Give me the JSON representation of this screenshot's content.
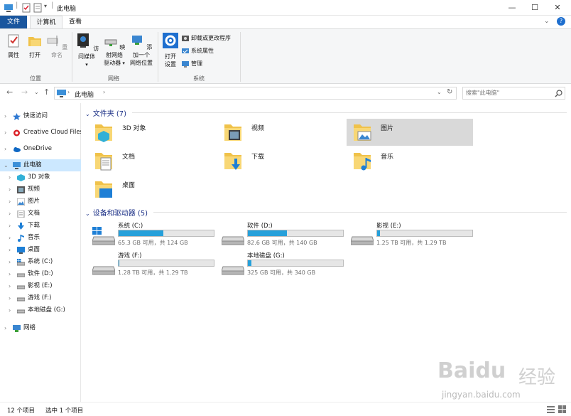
{
  "window": {
    "title": "此电脑"
  },
  "ribbon": {
    "tabs": [
      {
        "label": "文件"
      },
      {
        "label": "计算机"
      },
      {
        "label": "查看"
      }
    ],
    "groups": [
      {
        "label": "位置",
        "buttons": [
          {
            "label": "属性"
          },
          {
            "label": "打开"
          },
          {
            "label": "重命名"
          }
        ]
      },
      {
        "label": "网络",
        "buttons": [
          {
            "label": "访问媒体"
          },
          {
            "label": "映射网络驱动器"
          },
          {
            "label": "添加一个网络位置"
          }
        ]
      },
      {
        "label": "系统",
        "buttons": [
          {
            "label": "打开设置"
          }
        ],
        "small": [
          {
            "label": "卸载或更改程序"
          },
          {
            "label": "系统属性"
          },
          {
            "label": "管理"
          }
        ]
      }
    ],
    "net_btn2_line1": "映射网络",
    "net_btn2_line2": "驱动器",
    "net_btn3_line1": "添加一个",
    "net_btn3_line2": "网络位置",
    "sys_btn_line1": "打开",
    "sys_btn_line2": "设置"
  },
  "address": {
    "path": "此电脑",
    "search_placeholder": "搜索\"此电脑\""
  },
  "navpane": {
    "items": [
      {
        "label": "快速访问"
      },
      {
        "label": "Creative Cloud Files"
      },
      {
        "label": "OneDrive"
      },
      {
        "label": "此电脑"
      },
      {
        "label": "3D 对象"
      },
      {
        "label": "视频"
      },
      {
        "label": "图片"
      },
      {
        "label": "文档"
      },
      {
        "label": "下载"
      },
      {
        "label": "音乐"
      },
      {
        "label": "桌面"
      },
      {
        "label": "系统 (C:)"
      },
      {
        "label": "软件 (D:)"
      },
      {
        "label": "影视 (E:)"
      },
      {
        "label": "游戏 (F:)"
      },
      {
        "label": "本地磁盘 (G:)"
      },
      {
        "label": "网络"
      }
    ]
  },
  "content": {
    "folders_header": "文件夹 (7)",
    "folders": [
      {
        "label": "3D 对象"
      },
      {
        "label": "视频"
      },
      {
        "label": "图片"
      },
      {
        "label": "文档"
      },
      {
        "label": "下载"
      },
      {
        "label": "音乐"
      },
      {
        "label": "桌面"
      }
    ],
    "drives_header": "设备和驱动器 (5)",
    "drives": [
      {
        "name": "系统 (C:)",
        "free": "65.3 GB 可用，共 124 GB",
        "used_fraction": 0.47
      },
      {
        "name": "软件 (D:)",
        "free": "82.6 GB 可用，共 140 GB",
        "used_fraction": 0.41
      },
      {
        "name": "影视 (E:)",
        "free": "1.25 TB 可用，共 1.29 TB",
        "used_fraction": 0.03
      },
      {
        "name": "游戏 (F:)",
        "free": "1.28 TB 可用，共 1.29 TB",
        "used_fraction": 0.01
      },
      {
        "name": "本地磁盘 (G:)",
        "free": "325 GB 可用，共 340 GB",
        "used_fraction": 0.04
      }
    ]
  },
  "status": {
    "count": "12 个项目",
    "selected": "选中 1 个项目"
  },
  "watermark": {
    "brand": "Baidu",
    "brand2": "经验",
    "url": "jingyan.baidu.com"
  },
  "colors": {
    "accent": "#19569e",
    "selection": "#cce8ff",
    "drive_fill": "#26a0da",
    "folder": "#f8d775"
  }
}
